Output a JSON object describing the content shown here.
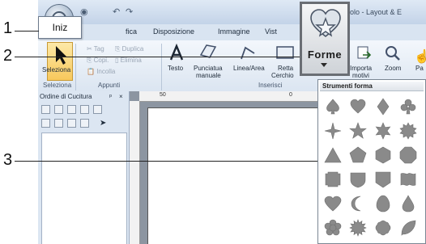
{
  "window": {
    "title_partial": "enza titolo - Layout & E"
  },
  "quick_access": [
    "◉",
    "↶",
    "↷"
  ],
  "tabs": {
    "active": "Iniz",
    "items": [
      "fica",
      "Disposizione",
      "Immagine",
      "Vist"
    ]
  },
  "ribbon": {
    "select_label": "Seleziona",
    "clipboard": {
      "tag": "Tag",
      "duplica": "Duplica",
      "copi": "Copi.",
      "elimina": "Elimina",
      "incolla": "Incolla"
    },
    "text_label": "Testo",
    "punch_label_1": "Punciatua",
    "punch_label_2": "manuale",
    "line_label": "Linea/Area",
    "rect_label_1": "Retta",
    "rect_label_2": "Cerchio",
    "shapes_label": "Forme",
    "import_label": "Importa",
    "import_label_2": "motivi",
    "zoom_label": "Zoom",
    "pan_label": "Pa"
  },
  "group_labels": {
    "select": "Seleziona",
    "clipboard": "Appunti",
    "insert": "Inserisci"
  },
  "ordine_panel": {
    "title": "Ordine di Cucitura",
    "pin": "ᵖ",
    "close": "×"
  },
  "ruler": {
    "marks": [
      "50",
      "0"
    ]
  },
  "shapes_panel": {
    "title": "Strumenti forma",
    "shapes": [
      "spade",
      "heart",
      "diamond",
      "club",
      "four-point-star",
      "five-point-star",
      "six-point-star",
      "burst",
      "triangle",
      "pentagon",
      "hexagon",
      "octagon",
      "notched-square",
      "shield",
      "badge",
      "wave-banner",
      "heart-outline",
      "crescent",
      "egg",
      "droplet",
      "flower",
      "sun-burst",
      "scallop",
      "leaf"
    ]
  },
  "callouts": {
    "one": "1",
    "two": "2",
    "three": "3"
  },
  "colors": {
    "ribbon_bg": "#dbe5f1",
    "shape_fill": "#8a8a8a",
    "highlight": "#6a6e74"
  }
}
